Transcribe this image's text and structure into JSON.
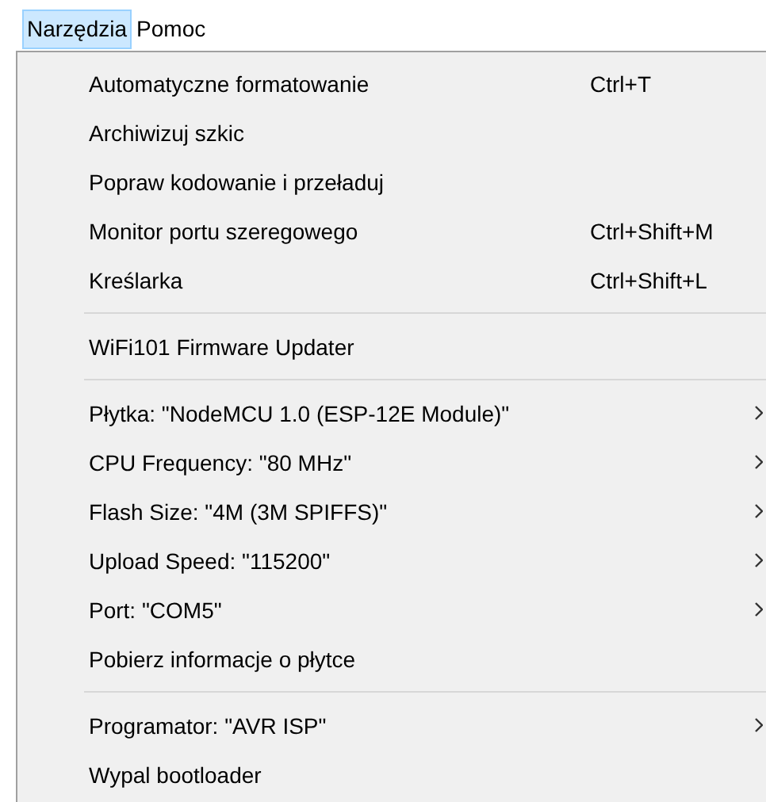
{
  "menubar": [
    {
      "label": "Narzędzia",
      "selected": true
    },
    {
      "label": "Pomoc",
      "selected": false
    }
  ],
  "menu": {
    "items": [
      {
        "kind": "item",
        "label": "Automatyczne formatowanie",
        "shortcut": "Ctrl+T",
        "submenu": false
      },
      {
        "kind": "item",
        "label": "Archiwizuj szkic",
        "submenu": false
      },
      {
        "kind": "item",
        "label": "Popraw kodowanie i przeładuj",
        "submenu": false
      },
      {
        "kind": "item",
        "label": "Monitor portu szeregowego",
        "shortcut": "Ctrl+Shift+M",
        "submenu": false
      },
      {
        "kind": "item",
        "label": "Kreślarka",
        "shortcut": "Ctrl+Shift+L",
        "submenu": false
      },
      {
        "kind": "separator"
      },
      {
        "kind": "item",
        "label": "WiFi101 Firmware Updater",
        "submenu": false
      },
      {
        "kind": "separator"
      },
      {
        "kind": "item",
        "label": "Płytka: \"NodeMCU 1.0 (ESP-12E Module)\"",
        "submenu": true
      },
      {
        "kind": "item",
        "label": "CPU Frequency: \"80 MHz\"",
        "submenu": true
      },
      {
        "kind": "item",
        "label": "Flash Size: \"4M (3M SPIFFS)\"",
        "submenu": true
      },
      {
        "kind": "item",
        "label": "Upload Speed: \"115200\"",
        "submenu": true
      },
      {
        "kind": "item",
        "label": "Port: \"COM5\"",
        "submenu": true
      },
      {
        "kind": "item",
        "label": "Pobierz informacje o płytce",
        "submenu": false
      },
      {
        "kind": "separator"
      },
      {
        "kind": "item",
        "label": "Programator: \"AVR ISP\"",
        "submenu": true
      },
      {
        "kind": "item",
        "label": "Wypal bootloader",
        "submenu": false
      }
    ]
  }
}
